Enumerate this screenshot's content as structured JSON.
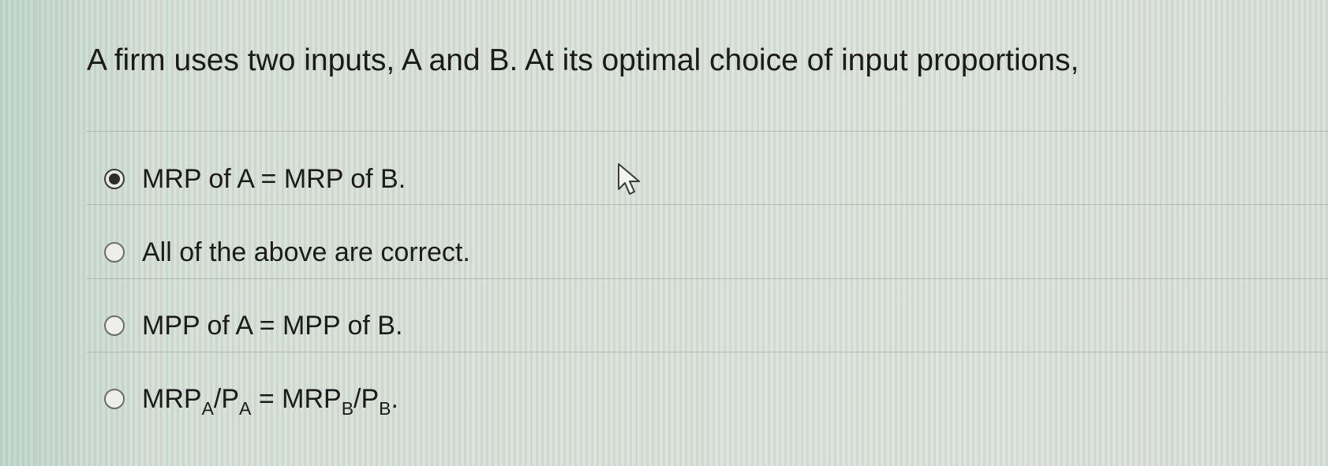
{
  "question": {
    "text": "A firm uses two inputs, A and B. At its optimal choice of input proportions,"
  },
  "options": [
    {
      "label": "MRP of A = MRP of B.",
      "checked": true
    },
    {
      "label": "All of the above are correct.",
      "checked": false
    },
    {
      "label": "MPP of A = MPP of B.",
      "checked": false
    },
    {
      "label_parts": {
        "p1": "MRP",
        "s1": "A",
        "p2": "/P",
        "s2": "A",
        "p3": " = MRP",
        "s3": "B",
        "p4": "/P",
        "s4": "B",
        "p5": "."
      },
      "checked": false
    }
  ],
  "cursor": {
    "icon": "mouse-pointer-icon"
  }
}
